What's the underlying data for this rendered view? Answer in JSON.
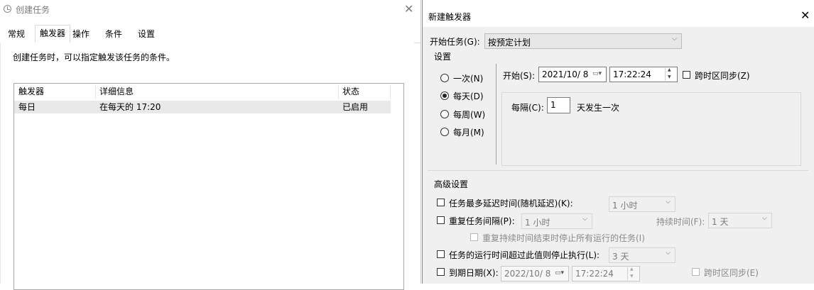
{
  "left_window": {
    "title": "创建任务",
    "tabs": [
      "常规",
      "触发器",
      "操作",
      "条件",
      "设置"
    ],
    "description": "创建任务时，可以指定触发该任务的条件。",
    "columns": [
      "触发器",
      "详细信息",
      "状态"
    ],
    "rows": [
      {
        "trigger": "每日",
        "details": "在每天的 17:20",
        "status": "已启用"
      }
    ]
  },
  "dialog": {
    "title": "新建触发器",
    "begin_task_label": "开始任务(G):",
    "begin_task_value": "按预定计划",
    "settings_label": "设置",
    "radios": [
      {
        "label": "一次(N)",
        "checked": false
      },
      {
        "label": "每天(D)",
        "checked": true
      },
      {
        "label": "每周(W)",
        "checked": false
      },
      {
        "label": "每月(M)",
        "checked": false
      }
    ],
    "start_label": "开始(S):",
    "start_date": "2021/10/ 8",
    "start_time": "17:22:24",
    "sync_tz_label": "跨时区同步(Z)",
    "every_label": "每隔(C):",
    "every_value": "1",
    "every_suffix": "天发生一次",
    "advanced_label": "高级设置",
    "delay_label": "任务最多延迟时间(随机延迟)(K):",
    "delay_value": "1 小时",
    "repeat_label": "重复任务间隔(P):",
    "repeat_value": "1 小时",
    "duration_label": "持续时间(F):",
    "duration_value": "1 天",
    "stop_all_label": "重复持续时间结束时停止所有运行的任务(I)",
    "stop_exceed_label": "任务的运行时间超过此值则停止执行(L):",
    "stop_exceed_value": "3 天",
    "expire_label": "到期日期(X):",
    "expire_date": "2022/10/ 8",
    "expire_time": "17:22:24",
    "expire_sync_label": "跨时区同步(E)"
  }
}
